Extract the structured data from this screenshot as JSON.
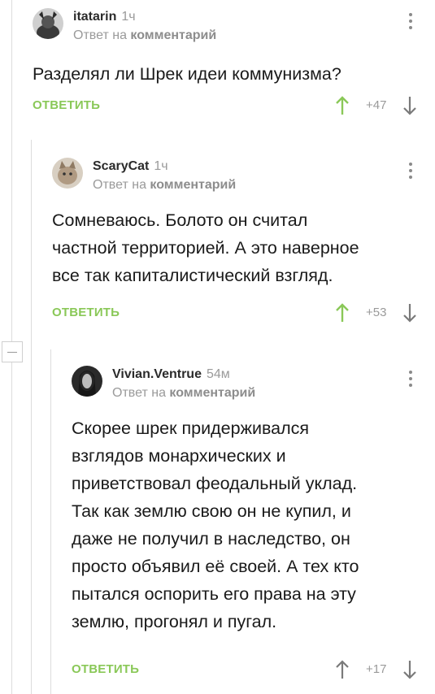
{
  "colors": {
    "accent_green": "#8ac858",
    "muted_gray": "#9a9a9a",
    "thread_line": "#dcdcdc"
  },
  "comments": [
    {
      "author": "itatarin",
      "time": "1ч",
      "reply_prefix": "Ответ на",
      "reply_target": "комментарий",
      "text": "Разделял ли Шрек идеи коммунизма?",
      "reply_label": "ОТВЕТИТЬ",
      "score": "+47",
      "icons": {
        "avatar": "avatar-image",
        "menu": "more-vertical-icon",
        "up": "arrow-up-icon",
        "down": "arrow-down-icon"
      }
    },
    {
      "author": "ScaryCat",
      "time": "1ч",
      "reply_prefix": "Ответ на",
      "reply_target": "комментарий",
      "text_lines": [
        "Сомневаюсь. Болото он считал",
        "частной территорией. А это наверное",
        "все так капиталистический взгляд."
      ],
      "reply_label": "ОТВЕТИТЬ",
      "score": "+53"
    },
    {
      "author": "Vivian.Ventrue",
      "time": "54м",
      "reply_prefix": "Ответ на",
      "reply_target": "комментарий",
      "text_lines": [
        "Скорее шрек придерживался",
        "взглядов монархических и",
        "приветствовал феодальный уклад.",
        "Так как землю свою он не купил, и",
        "даже не получил в наследство, он",
        "просто объявил её своей. А тех кто",
        "пытался оспорить его права на эту",
        "землю, прогонял и пугал."
      ],
      "reply_label": "ОТВЕТИТЬ",
      "score": "+17"
    }
  ]
}
